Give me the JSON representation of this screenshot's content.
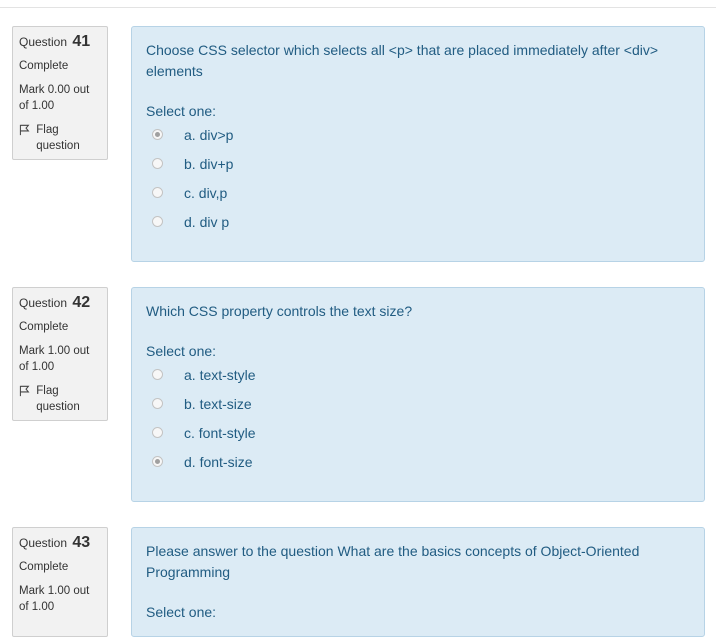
{
  "questions": [
    {
      "label": "Question",
      "number": "41",
      "state": "Complete",
      "mark": "Mark 0.00 out of 1.00",
      "flag": "Flag question",
      "text": "Choose CSS selector which selects all <p>  that are placed immediately after <div> elements",
      "prompt": "Select one:",
      "options": [
        {
          "label": "a. div>p",
          "checked": true
        },
        {
          "label": "b. div+p",
          "checked": false
        },
        {
          "label": "c. div,p",
          "checked": false
        },
        {
          "label": "d. div p",
          "checked": false
        }
      ]
    },
    {
      "label": "Question",
      "number": "42",
      "state": "Complete",
      "mark": "Mark 1.00 out of 1.00",
      "flag": "Flag question",
      "text": "Which CSS property controls the text size?",
      "prompt": "Select one:",
      "options": [
        {
          "label": "a. text-style",
          "checked": false
        },
        {
          "label": "b. text-size",
          "checked": false
        },
        {
          "label": "c. font-style",
          "checked": false
        },
        {
          "label": "d. font-size",
          "checked": true
        }
      ]
    },
    {
      "label": "Question",
      "number": "43",
      "state": "Complete",
      "mark": "Mark 1.00 out of 1.00",
      "flag": "Flag question",
      "text": "Please answer to the question What are the basics concepts of Object-Oriented Programming",
      "prompt": "Select one:",
      "options": []
    }
  ]
}
